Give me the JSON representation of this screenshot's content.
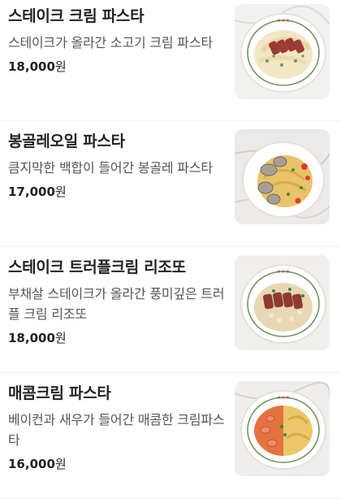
{
  "menu": {
    "items": [
      {
        "name": "스테이크 크림 파스타",
        "description": "스테이크가 올라간 소고기 크림 파스타",
        "price": "18,000",
        "currency": "원",
        "image_icon": "steak-cream-pasta-photo"
      },
      {
        "name": "봉골레오일 파스타",
        "description": "큼지막한 백합이 들어간 봉골레 파스타",
        "price": "17,000",
        "currency": "원",
        "image_icon": "vongole-oil-pasta-photo"
      },
      {
        "name": "스테이크 트러플크림 리조또",
        "description": "부채살 스테이크가 올라간 풍미깊은 트러플 크림 리조또",
        "price": "18,000",
        "currency": "원",
        "image_icon": "steak-truffle-risotto-photo"
      },
      {
        "name": "매콤크림 파스타",
        "description": "베이컨과 새우가 들어간 매콤한 크림파스타",
        "price": "16,000",
        "currency": "원",
        "image_icon": "spicy-cream-pasta-photo"
      }
    ]
  }
}
